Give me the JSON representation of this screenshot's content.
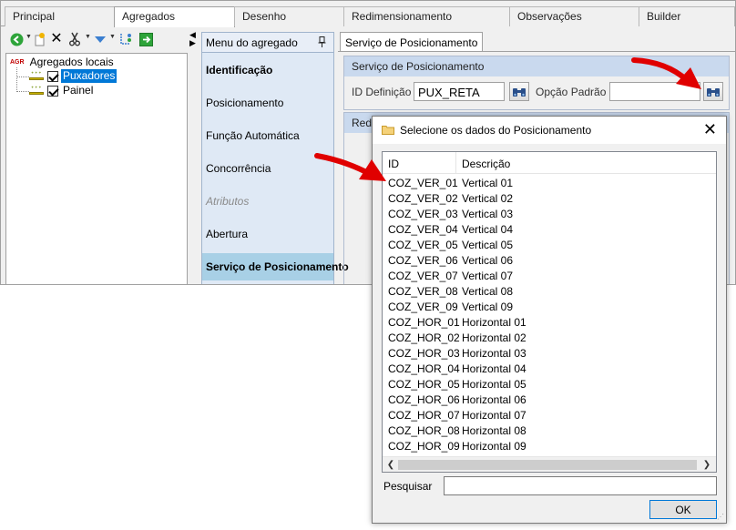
{
  "tabs": [
    {
      "label": "Principal",
      "active": false
    },
    {
      "label": "Agregados",
      "active": true
    },
    {
      "label": "Desenho",
      "active": false
    },
    {
      "label": "Redimensionamento",
      "active": false
    },
    {
      "label": "Observações",
      "active": false
    },
    {
      "label": "Builder",
      "active": false
    }
  ],
  "tree": {
    "root_tag": "AGR",
    "root_label": "Agregados locais",
    "items": [
      {
        "label": "Puxadores",
        "checked": true,
        "selected": true
      },
      {
        "label": "Painel",
        "checked": true,
        "selected": false
      }
    ]
  },
  "menu": {
    "header": "Menu do agregado",
    "pin_icon": "pin-icon",
    "items": [
      {
        "label": "Identificação",
        "style": "bold"
      },
      {
        "label": "Posicionamento",
        "style": "normal"
      },
      {
        "label": "Função Automática",
        "style": "normal"
      },
      {
        "label": "Concorrência",
        "style": "normal"
      },
      {
        "label": "Atributos",
        "style": "disabled"
      },
      {
        "label": "Abertura",
        "style": "normal"
      },
      {
        "label": "Serviço de Posicionamento",
        "style": "selected"
      }
    ]
  },
  "content": {
    "tab_label": "Serviço de Posicionamento",
    "group_title": "Serviço de Posicionamento",
    "id_definicao_label": "ID Definição",
    "id_definicao_value": "PUX_RETA",
    "opcao_padrao_label": "Opção Padrão",
    "opcao_padrao_value": "",
    "group2_title": "Redi"
  },
  "dialog": {
    "title": "Selecione os dados do Posicionamento",
    "columns": {
      "id": "ID",
      "desc": "Descrição"
    },
    "rows": [
      {
        "id": "COZ_VER_01",
        "desc": "Vertical 01"
      },
      {
        "id": "COZ_VER_02",
        "desc": "Vertical 02"
      },
      {
        "id": "COZ_VER_03",
        "desc": "Vertical 03"
      },
      {
        "id": "COZ_VER_04",
        "desc": "Vertical 04"
      },
      {
        "id": "COZ_VER_05",
        "desc": "Vertical 05"
      },
      {
        "id": "COZ_VER_06",
        "desc": "Vertical 06"
      },
      {
        "id": "COZ_VER_07",
        "desc": "Vertical 07"
      },
      {
        "id": "COZ_VER_08",
        "desc": "Vertical 08"
      },
      {
        "id": "COZ_VER_09",
        "desc": "Vertical 09"
      },
      {
        "id": "COZ_HOR_01",
        "desc": "Horizontal 01"
      },
      {
        "id": "COZ_HOR_02",
        "desc": "Horizontal 02"
      },
      {
        "id": "COZ_HOR_03",
        "desc": "Horizontal 03"
      },
      {
        "id": "COZ_HOR_04",
        "desc": "Horizontal 04"
      },
      {
        "id": "COZ_HOR_05",
        "desc": "Horizontal 05"
      },
      {
        "id": "COZ_HOR_06",
        "desc": "Horizontal 06"
      },
      {
        "id": "COZ_HOR_07",
        "desc": "Horizontal 07"
      },
      {
        "id": "COZ_HOR_08",
        "desc": "Horizontal 08"
      },
      {
        "id": "COZ_HOR_09",
        "desc": "Horizontal 09"
      }
    ],
    "search_label": "Pesquisar",
    "search_value": "",
    "ok_label": "OK"
  },
  "colors": {
    "accent": "#0078d7",
    "menu_bg": "#dfe9f5",
    "menu_selected": "#a8d0e6",
    "group_header": "#c9d9ee",
    "annotation_arrow": "#e00000"
  }
}
